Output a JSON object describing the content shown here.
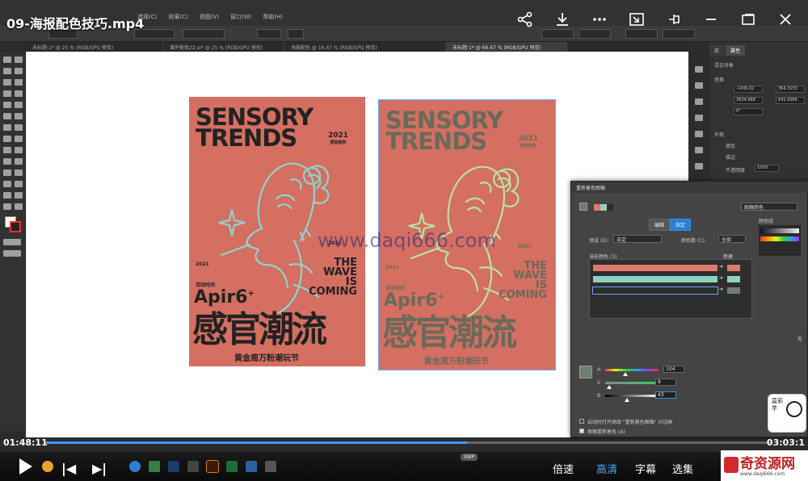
{
  "video": {
    "title": "09-海报配色技巧.mp4",
    "time_current": "01:48:11",
    "time_total": "03:03:1",
    "progress": 0.58,
    "swp_label": "SWP",
    "controls": {
      "speed": "倍速",
      "quality": "高清",
      "subtitle": "字幕",
      "episodes": "选集"
    }
  },
  "app_menu": [
    "选择(C)",
    "效果(C)",
    "视图(V)",
    "窗口(W)",
    "帮助(H)"
  ],
  "doc_tabs": [
    "未标题-1* @ 25 % (RGB/GPU 预览)",
    "课件配色22.ai* @ 25 % (RGB/GPU 预览)",
    "海报配色 @ 16.67 % (RGB/GPU 预览)",
    "未标题-1* @ 66.67 % (RGB/GPU 预览)"
  ],
  "poster": {
    "title_line1": "SENSORY",
    "title_line2": "TRENDS",
    "year": "2021",
    "year_sub": "感官趋势",
    "wave_lines": [
      "THE",
      "WAVE",
      "IS",
      "COMING"
    ],
    "date_label": "Apir6",
    "date_sup": "+",
    "cn_big": "感官潮流",
    "cn_sub": "黄金周万粉潮玩节",
    "small_year": "2021",
    "event_label": "活动时间"
  },
  "watermark": "www.daqi666.com",
  "right_panel": {
    "tabs": [
      "库",
      "属性"
    ],
    "section_object": "混合对象",
    "section_transform": "变换",
    "x_value": "-1436.02",
    "w_value": "364.3153",
    "y_value": "3624.968",
    "h_value": "641.0066",
    "angle_value": "0°",
    "section_appearance": "外观",
    "fill_label": "填色",
    "stroke_label": "描边",
    "opacity_label": "不透明度",
    "opacity_value": "100%"
  },
  "recolor_dialog": {
    "title": "重新着色图稿",
    "tab_edit": "编辑",
    "tab_assign": "指定",
    "preset_label": "预设 (E):",
    "preset_value": "自定",
    "colors_label": "颜色数 (C):",
    "colors_value": "全部",
    "current_colors_label": "当前颜色 (3)",
    "new_label": "新建",
    "group_label": "颜色组",
    "group_value": "图稿颜色",
    "slider_values": [
      "104",
      "9",
      "43"
    ],
    "slider_letters": [
      "H",
      "S",
      "B"
    ],
    "option1": "启动时打开高级 \"重新着色图稿\" 对话框",
    "option2": "图稿重新着色 (A)",
    "none_label": "无",
    "colors": {
      "row1": "#e2786c",
      "row2": "#8fd1c0",
      "row3": "#2b2e2b",
      "swatch": "#6f7d73"
    }
  },
  "brand": {
    "name": "奇资源网",
    "url": "www.daqi666.com"
  },
  "mascot_text": "莫莉 芋",
  "colors": {
    "poster_bg": "#d46f62",
    "poster_text_left": "#222222",
    "poster_text_right": "#6a6a5a",
    "face_left": "#8fd4d0",
    "face_right": "#b8e2a0",
    "accent": "#3b9cff"
  }
}
